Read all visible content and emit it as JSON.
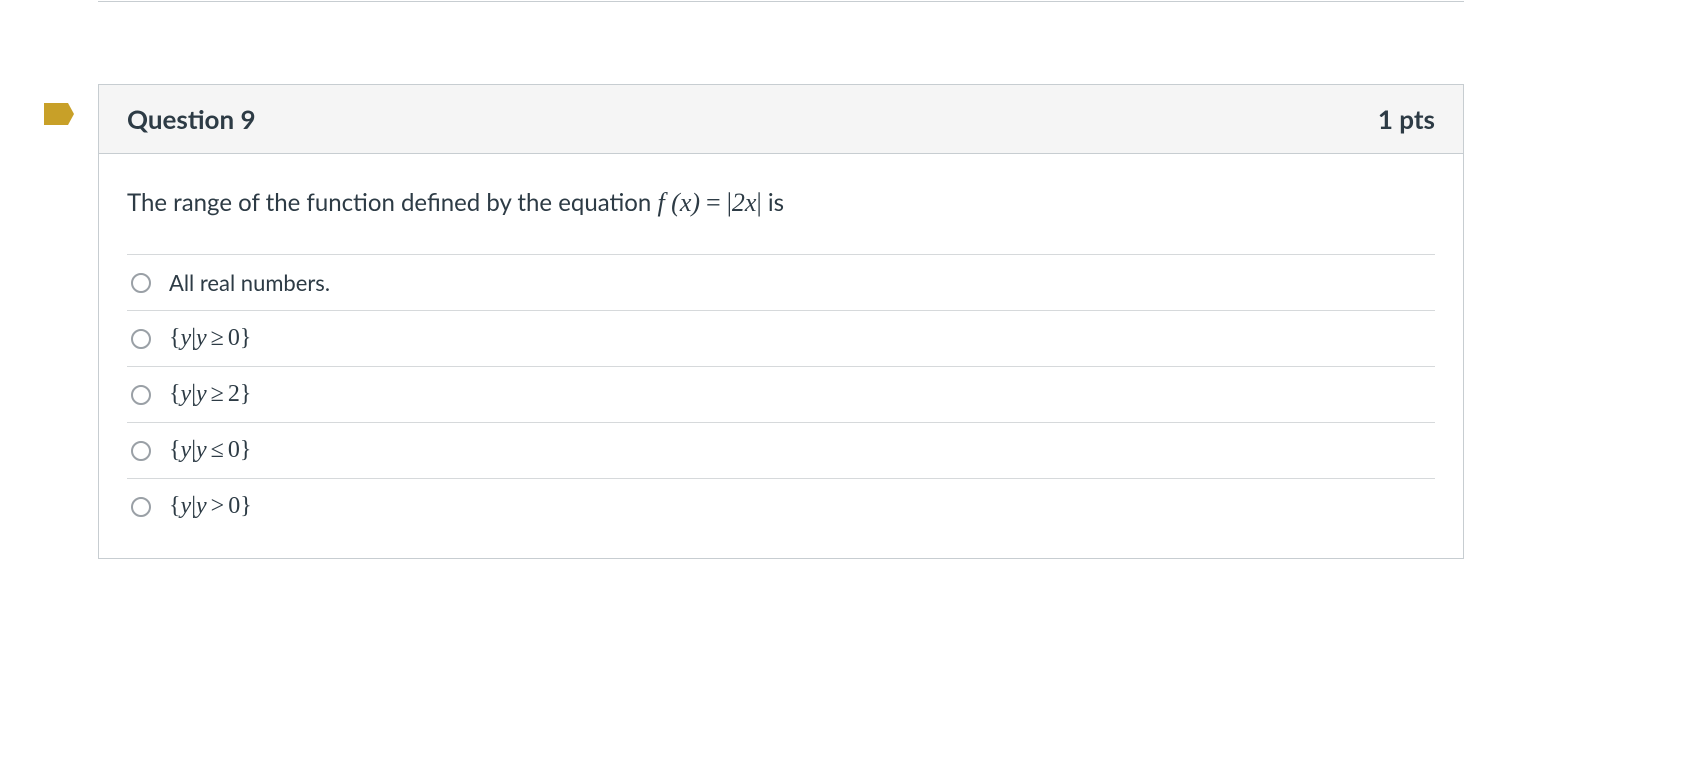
{
  "question": {
    "title": "Question 9",
    "points": "1 pts",
    "prompt_prefix": "The range of the function defined by the equation ",
    "prompt_math_fx": "f (x)",
    "prompt_math_eq": "=",
    "prompt_math_abs_open": "|",
    "prompt_math_expr": "2x",
    "prompt_math_abs_close": "|",
    "prompt_suffix": " is",
    "answers": [
      {
        "text": "All real numbers.",
        "is_math": false
      },
      {
        "text": "{y|y ≥ 0}",
        "is_math": true,
        "y": "y",
        "rel": "≥",
        "val": "0"
      },
      {
        "text": "{y|y ≥ 2}",
        "is_math": true,
        "y": "y",
        "rel": "≥",
        "val": "2"
      },
      {
        "text": "{y|y ≤ 0}",
        "is_math": true,
        "y": "y",
        "rel": "≤",
        "val": "0"
      },
      {
        "text": "{y|y > 0}",
        "is_math": true,
        "y": "y",
        "rel": ">",
        "val": "0"
      }
    ]
  }
}
